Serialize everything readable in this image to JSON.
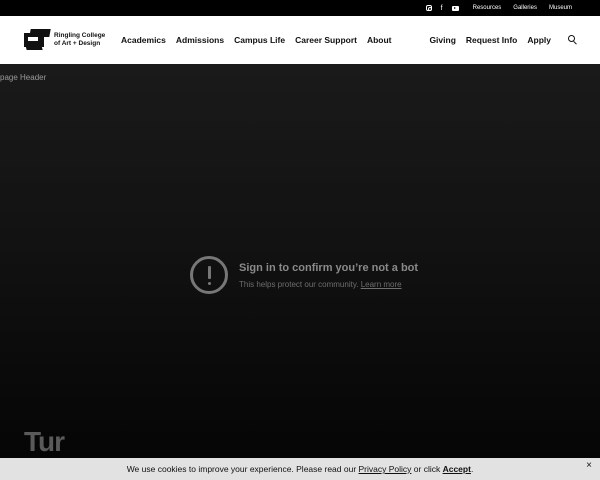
{
  "topbar": {
    "social_icons": [
      "instagram-icon",
      "facebook-icon",
      "youtube-icon"
    ],
    "links": [
      "Resources",
      "Galleries",
      "Museum"
    ]
  },
  "logo": {
    "line1": "Ringling College",
    "line2": "of Art + Design"
  },
  "nav": {
    "left": [
      "Academics",
      "Admissions",
      "Campus Life",
      "Career Support",
      "About"
    ],
    "right": [
      "Giving",
      "Request Info",
      "Apply"
    ]
  },
  "hero": {
    "label": "page Header",
    "bot_title": "Sign in to confirm you’re not a bot",
    "bot_sub": "This helps protect our community.",
    "bot_link": "Learn more",
    "partial_text": "Tur"
  },
  "cookie": {
    "text_a": "We use cookies to improve your experience. Please read our ",
    "policy": "Privacy Policy",
    "text_b": " or click ",
    "accept": "Accept",
    "text_c": ".",
    "close": "×"
  },
  "colors": {
    "topbar": "#000000",
    "nav_bg": "#ffffff",
    "hero_bg": "#141414",
    "cookie_bg": "#e2e2e2"
  }
}
